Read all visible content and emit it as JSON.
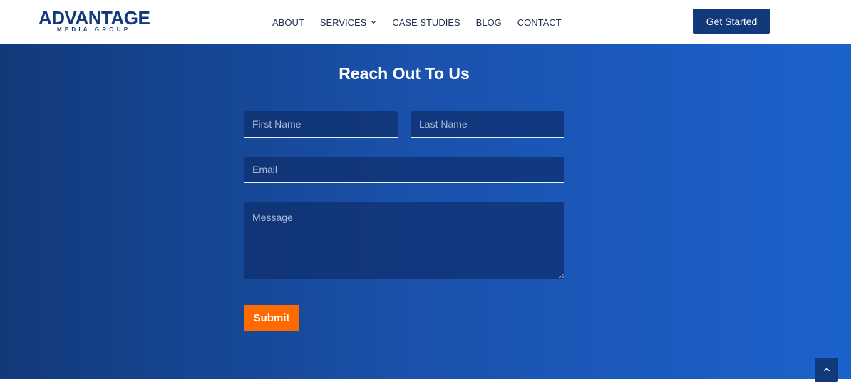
{
  "header": {
    "logo": {
      "main": "ADVANTAGE",
      "sub": "MEDIA GROUP"
    },
    "nav": [
      {
        "label": "ABOUT",
        "has_dropdown": false
      },
      {
        "label": "SERVICES",
        "has_dropdown": true,
        "icon": "chevron-down-icon"
      },
      {
        "label": "CASE STUDIES",
        "has_dropdown": false
      },
      {
        "label": "BLOG",
        "has_dropdown": false
      },
      {
        "label": "CONTACT",
        "has_dropdown": false
      }
    ],
    "cta_label": "Get Started"
  },
  "form": {
    "title": "Reach Out To Us",
    "first_name": {
      "placeholder": "First Name",
      "value": ""
    },
    "last_name": {
      "placeholder": "Last Name",
      "value": ""
    },
    "email": {
      "placeholder": "Email",
      "value": ""
    },
    "message": {
      "placeholder": "Message",
      "value": ""
    },
    "submit_label": "Submit"
  },
  "scroll_top": {
    "icon": "chevron-up-icon"
  },
  "colors": {
    "brand_navy": "#123a7a",
    "gradient_start": "#123a7a",
    "gradient_end": "#1c62cc",
    "submit_orange": "#ff6a00"
  }
}
